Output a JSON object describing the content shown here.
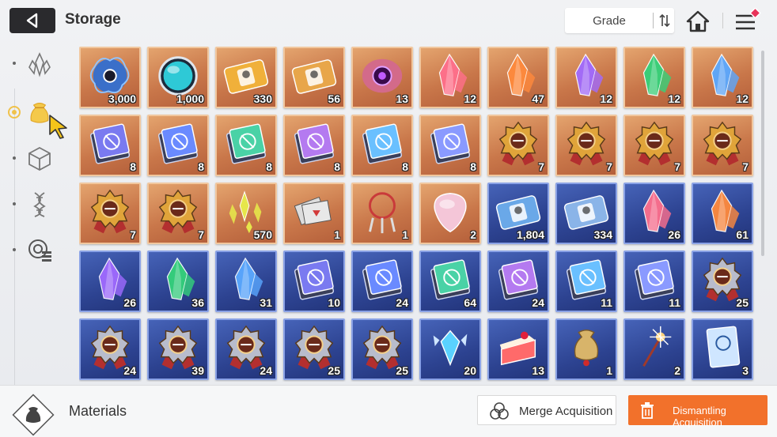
{
  "header": {
    "title": "Storage",
    "sort_label": "Grade",
    "back_icon": "back-arrow-icon",
    "home_icon": "home-icon",
    "menu_icon": "menu-icon"
  },
  "sidebar": {
    "items": [
      {
        "name": "crystal-tab",
        "icon": "crystal-icon",
        "active": false
      },
      {
        "name": "materials-tab",
        "icon": "pouch-icon",
        "active": true
      },
      {
        "name": "box-tab",
        "icon": "cube-icon",
        "active": false
      },
      {
        "name": "dna-tab",
        "icon": "dna-icon",
        "active": false
      },
      {
        "name": "chip-tab",
        "icon": "chip-icon",
        "active": false
      }
    ]
  },
  "inventory": {
    "items": [
      {
        "type": "core",
        "color": "#3a6fc9",
        "count": "3,000",
        "tier": "orange"
      },
      {
        "type": "orb",
        "color": "#2ec9d6",
        "count": "1,000",
        "tier": "orange"
      },
      {
        "type": "ticket",
        "color": "#f0b03a",
        "count": "330",
        "tier": "orange"
      },
      {
        "type": "ticket",
        "color": "#e8a64a",
        "count": "56",
        "tier": "orange"
      },
      {
        "type": "eye",
        "color": "#d36a8a",
        "count": "13",
        "tier": "orange"
      },
      {
        "type": "crystal",
        "color": "#ff6f8c",
        "count": "12",
        "tier": "orange"
      },
      {
        "type": "crystal",
        "color": "#ff8a3c",
        "count": "47",
        "tier": "orange"
      },
      {
        "type": "crystal",
        "color": "#a06aff",
        "count": "12",
        "tier": "orange"
      },
      {
        "type": "crystal",
        "color": "#34d27a",
        "count": "12",
        "tier": "orange"
      },
      {
        "type": "crystal",
        "color": "#5aa8ff",
        "count": "12",
        "tier": "orange"
      },
      {
        "type": "book",
        "color": "#7a7af0",
        "count": "8",
        "tier": "orange"
      },
      {
        "type": "book",
        "color": "#6a8aff",
        "count": "8",
        "tier": "orange"
      },
      {
        "type": "book",
        "color": "#4ad2a6",
        "count": "8",
        "tier": "orange"
      },
      {
        "type": "book",
        "color": "#b47af0",
        "count": "8",
        "tier": "orange"
      },
      {
        "type": "book",
        "color": "#6ac0ff",
        "count": "8",
        "tier": "orange"
      },
      {
        "type": "book",
        "color": "#8a9aff",
        "count": "8",
        "tier": "orange"
      },
      {
        "type": "medal",
        "color": "#e0a43a",
        "count": "7",
        "tier": "orange"
      },
      {
        "type": "medal",
        "color": "#e0a43a",
        "count": "7",
        "tier": "orange"
      },
      {
        "type": "medal",
        "color": "#e0a43a",
        "count": "7",
        "tier": "orange"
      },
      {
        "type": "medal",
        "color": "#e0a43a",
        "count": "7",
        "tier": "orange"
      },
      {
        "type": "medal",
        "color": "#e0a43a",
        "count": "7",
        "tier": "orange"
      },
      {
        "type": "medal",
        "color": "#e0a43a",
        "count": "7",
        "tier": "orange"
      },
      {
        "type": "shards",
        "color": "#e6e64a",
        "count": "570",
        "tier": "orange"
      },
      {
        "type": "cards",
        "color": "#e8e8e8",
        "count": "1",
        "tier": "orange"
      },
      {
        "type": "dreamcatcher",
        "color": "#c93a3a",
        "count": "1",
        "tier": "orange"
      },
      {
        "type": "pick",
        "color": "#f4c6d8",
        "count": "2",
        "tier": "orange"
      },
      {
        "type": "ticket",
        "color": "#6aa8e8",
        "count": "1,804",
        "tier": "blue"
      },
      {
        "type": "ticket",
        "color": "#8ab4e8",
        "count": "334",
        "tier": "blue"
      },
      {
        "type": "crystal",
        "color": "#ff6f8c",
        "count": "26",
        "tier": "blue"
      },
      {
        "type": "crystal",
        "color": "#ff8a3c",
        "count": "61",
        "tier": "blue"
      },
      {
        "type": "crystal",
        "color": "#a06aff",
        "count": "26",
        "tier": "blue"
      },
      {
        "type": "crystal",
        "color": "#34d27a",
        "count": "36",
        "tier": "blue"
      },
      {
        "type": "crystal",
        "color": "#5aa8ff",
        "count": "31",
        "tier": "blue"
      },
      {
        "type": "book",
        "color": "#7a7af0",
        "count": "10",
        "tier": "blue"
      },
      {
        "type": "book",
        "color": "#6a8aff",
        "count": "24",
        "tier": "blue"
      },
      {
        "type": "book",
        "color": "#4ad2a6",
        "count": "64",
        "tier": "blue"
      },
      {
        "type": "book",
        "color": "#b47af0",
        "count": "24",
        "tier": "blue"
      },
      {
        "type": "book",
        "color": "#6ac0ff",
        "count": "11",
        "tier": "blue"
      },
      {
        "type": "book",
        "color": "#8a9aff",
        "count": "11",
        "tier": "blue"
      },
      {
        "type": "medal",
        "color": "#b8bccc",
        "count": "25",
        "tier": "blue"
      },
      {
        "type": "medal",
        "color": "#b8bccc",
        "count": "24",
        "tier": "blue"
      },
      {
        "type": "medal",
        "color": "#b8bccc",
        "count": "39",
        "tier": "blue"
      },
      {
        "type": "medal",
        "color": "#b8bccc",
        "count": "24",
        "tier": "blue"
      },
      {
        "type": "medal",
        "color": "#b8bccc",
        "count": "25",
        "tier": "blue"
      },
      {
        "type": "medal",
        "color": "#b8bccc",
        "count": "25",
        "tier": "blue"
      },
      {
        "type": "gem",
        "color": "#5ad2ff",
        "count": "20",
        "tier": "blue"
      },
      {
        "type": "cake",
        "color": "#ff6a6a",
        "count": "13",
        "tier": "blue"
      },
      {
        "type": "pouch",
        "color": "#d8b46a",
        "count": "1",
        "tier": "blue"
      },
      {
        "type": "sparkler",
        "color": "#ffd27a",
        "count": "2",
        "tier": "blue"
      },
      {
        "type": "manual",
        "color": "#cfe6ff",
        "count": "3",
        "tier": "blue"
      }
    ]
  },
  "footer": {
    "category_label": "Materials",
    "category_icon": "pouch-icon",
    "merge_label": "Merge Acquisition",
    "dismantle_label": "Dismantling Acquisition"
  },
  "colors": {
    "accent": "#f2712b",
    "orange_tier": "#c9774a",
    "blue_tier": "#2d4391"
  }
}
